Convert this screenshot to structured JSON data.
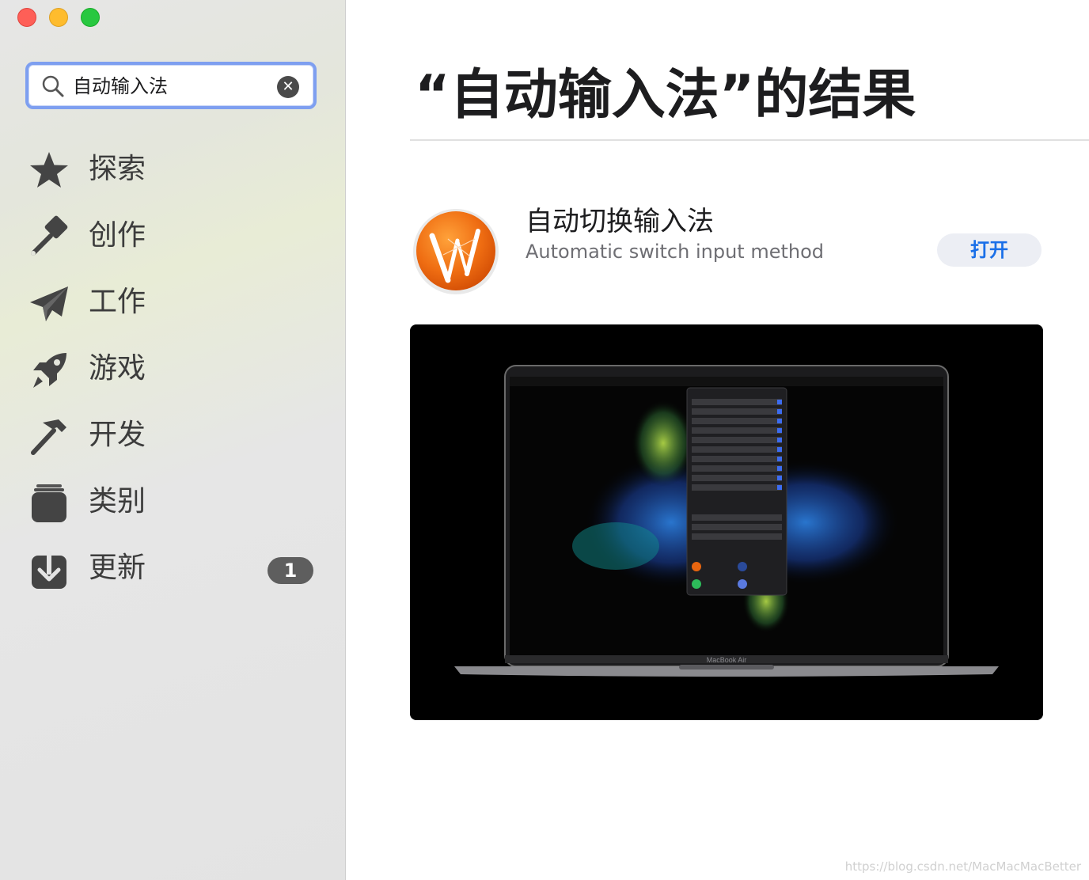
{
  "window": {
    "controls": [
      "close",
      "minimize",
      "zoom"
    ]
  },
  "search": {
    "value": "自动输入法",
    "icon": "search-icon",
    "clear_icon": "clear-icon"
  },
  "sidebar": {
    "items": [
      {
        "label": "探索",
        "icon": "star-icon"
      },
      {
        "label": "创作",
        "icon": "brush-icon"
      },
      {
        "label": "工作",
        "icon": "paper-plane-icon"
      },
      {
        "label": "游戏",
        "icon": "rocket-icon"
      },
      {
        "label": "开发",
        "icon": "hammer-icon"
      },
      {
        "label": "类别",
        "icon": "stack-icon"
      },
      {
        "label": "更新",
        "icon": "download-icon",
        "badge": "1"
      }
    ]
  },
  "main": {
    "title": "“自动输入法”的结果",
    "result": {
      "name": "自动切换输入法",
      "subtitle": "Automatic switch input method",
      "button": "打开",
      "screenshot_caption": "MacBook Air"
    }
  },
  "watermark": "https://blog.csdn.net/MacMacMacBetter",
  "colors": {
    "search_border": "#7e9ff0",
    "open_button_text": "#1a6fe8",
    "badge": "#5e5e5e",
    "app_icon": "#e8650f"
  }
}
